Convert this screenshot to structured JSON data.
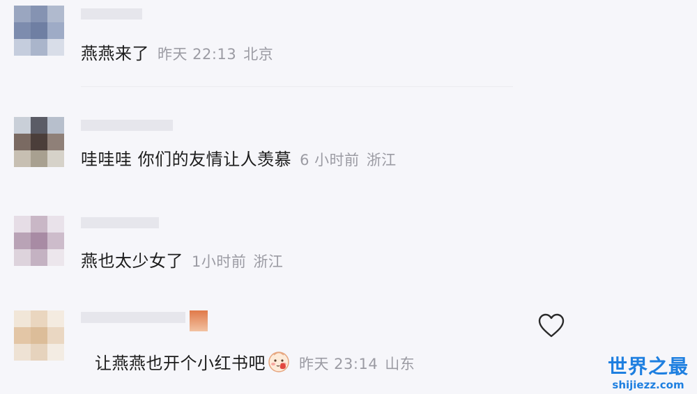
{
  "comments": [
    {
      "text": "燕燕来了",
      "time": "昨天 22:13",
      "location": "北京"
    },
    {
      "text": "哇哇哇 你们的友情让人羡慕",
      "time": "6 小时前",
      "location": "浙江"
    },
    {
      "text": "燕也太少女了",
      "time": "1小时前",
      "location": "浙江"
    },
    {
      "text": "让燕燕也开个小红书吧",
      "emoji": "blushing-face-emoji",
      "time": "昨天 23:14",
      "location": "山东"
    }
  ],
  "like_icon": "heart-outline-icon",
  "watermark": {
    "title": "世界之最",
    "url": "shijiezz.com"
  },
  "colors": {
    "background": "#f6f6fa",
    "comment_text": "#1c1c1c",
    "meta_text": "#9b9ba3",
    "watermark": "#1e7fe0"
  }
}
